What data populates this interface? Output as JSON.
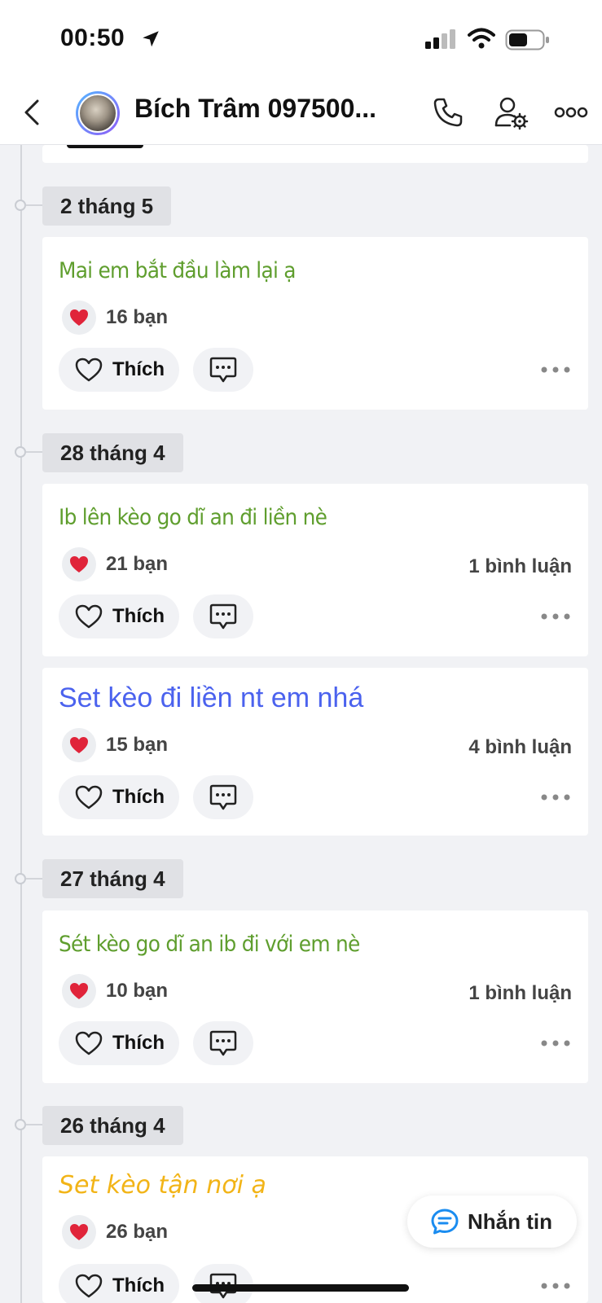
{
  "status_bar": {
    "time": "00:50"
  },
  "header": {
    "title": "Bích Trâm 097500...",
    "back_icon": "chevron-left-icon",
    "call_icon": "phone-icon",
    "settings_icon": "user-settings-icon",
    "more_icon": "more-icon"
  },
  "accent_colors": {
    "green": "#5f9e2e",
    "blue": "#4b62ee",
    "yellow": "#f2b417",
    "heart": "#e0243a"
  },
  "labels": {
    "like": "Thích",
    "message": "Nhắn tin"
  },
  "groups": [
    {
      "date": "2 tháng 5",
      "posts": [
        {
          "text": "Mai em bắt đầu làm lại ạ",
          "likes": "16 bạn",
          "comments": ""
        }
      ]
    },
    {
      "date": "28 tháng 4",
      "posts": [
        {
          "text": "Ib lên kèo go dĩ an đi liền nè",
          "likes": "21 bạn",
          "comments": "1 bình luận"
        },
        {
          "text": "Set kèo đi liền nt em nhá",
          "likes": "15 bạn",
          "comments": "4 bình luận"
        }
      ]
    },
    {
      "date": "27 tháng 4",
      "posts": [
        {
          "text": "Sét kèo go dĩ an ib đi với em nè",
          "likes": "10 bạn",
          "comments": "1 bình luận"
        }
      ]
    },
    {
      "date": "26 tháng 4",
      "posts": [
        {
          "text": "Set kèo tận nơi ạ",
          "likes": "26 bạn",
          "comments": ""
        }
      ]
    }
  ]
}
